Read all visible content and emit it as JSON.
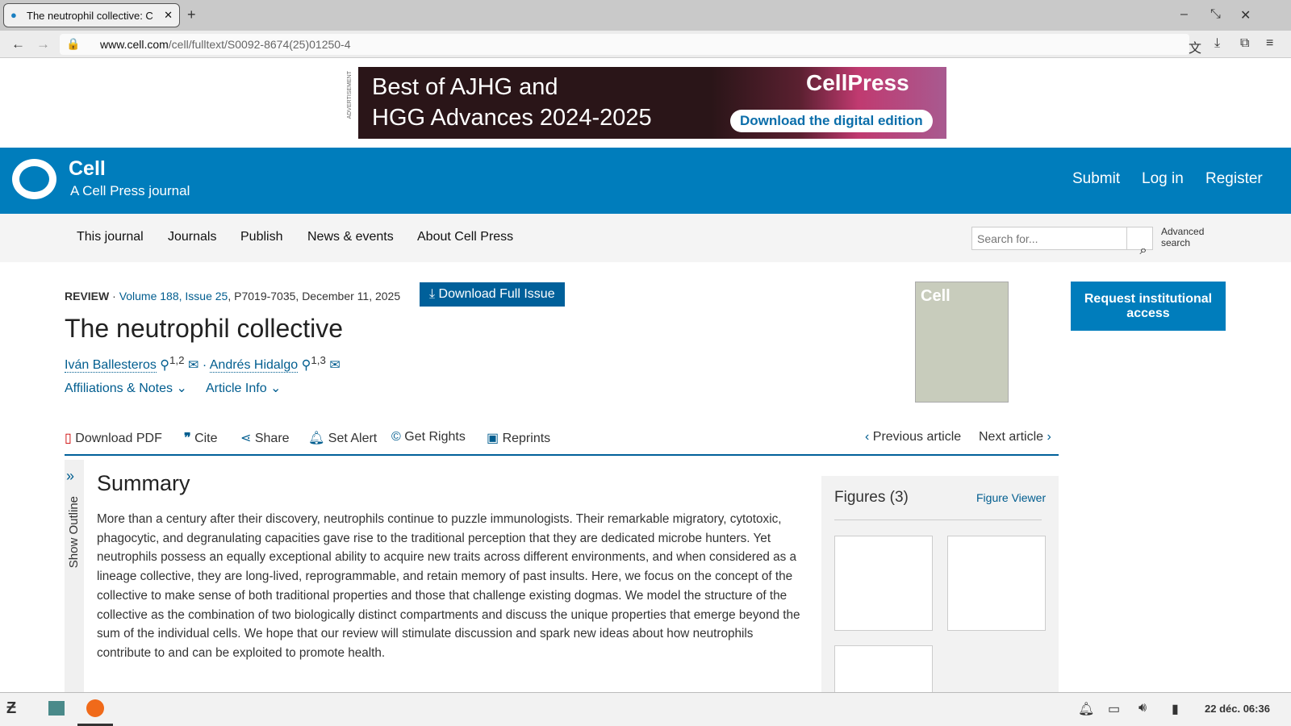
{
  "browser": {
    "tab_title": "The neutrophil collective: C",
    "url_domain": "www.cell.com",
    "url_path": "/cell/fulltext/S0092-8674(25)01250-4"
  },
  "ad": {
    "label": "ADVERTISEMENT",
    "line1": "Best of AJHG and",
    "line2": "HGG Advances 2024-2025",
    "brand": "CellPress",
    "cta": "Download the digital edition"
  },
  "header": {
    "logo": "Cell",
    "subtitle": "A Cell Press journal",
    "submit": "Submit",
    "login": "Log in",
    "register": "Register"
  },
  "nav": {
    "items": [
      "This journal",
      "Journals",
      "Publish",
      "News & events",
      "About Cell Press"
    ],
    "search_placeholder": "Search for...",
    "advanced1": "Advanced",
    "advanced2": "search"
  },
  "article": {
    "type": "REVIEW",
    "volume": "Volume 188, Issue 25",
    "pages": ", P7019-7035, December 11, 2025",
    "download_issue": "Download Full Issue",
    "title": "The neutrophil collective",
    "authors": [
      {
        "name": "Iván Ballesteros",
        "sup": "1,2"
      },
      {
        "name": "Andrés Hidalgo",
        "sup": "1,3"
      }
    ],
    "affiliations": "Affiliations & Notes",
    "article_info": "Article Info",
    "access": "Request institutional access"
  },
  "tools": {
    "pdf": "Download PDF",
    "cite": "Cite",
    "share": "Share",
    "alert": "Set Alert",
    "rights": "Get Rights",
    "reprints": "Reprints",
    "prev": "Previous article",
    "next": "Next article"
  },
  "outline": "Show Outline",
  "summary": {
    "heading": "Summary",
    "text": "More than a century after their discovery, neutrophils continue to puzzle immunologists. Their remarkable migratory, cytotoxic, phagocytic, and degranulating capacities gave rise to the traditional perception that they are dedicated microbe hunters. Yet neutrophils possess an equally exceptional ability to acquire new traits across different environments, and when considered as a lineage collective, they are long-lived, reprogrammable, and retain memory of past insults. Here, we focus on the concept of the collective to make sense of both traditional properties and those that challenge existing dogmas. We model the structure of the collective as the combination of two biologically distinct compartments and discuss the unique properties that emerge beyond the sum of the individual cells. We hope that our review will stimulate discussion and spark new ideas about how neutrophils contribute to and can be exploited to promote health."
  },
  "figures": {
    "heading": "Figures (3)",
    "viewer": "Figure Viewer"
  },
  "taskbar": {
    "clock": "22 déc. 06:36"
  }
}
